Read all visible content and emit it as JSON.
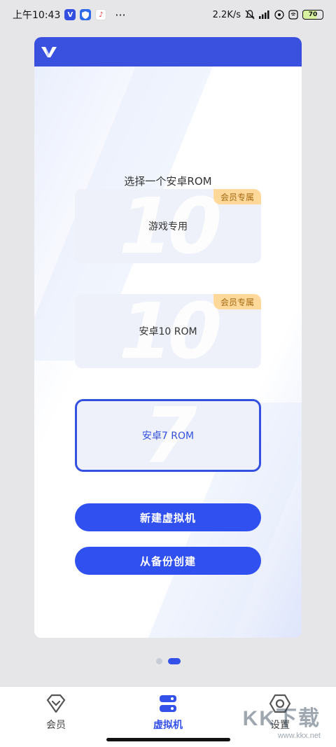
{
  "status_bar": {
    "time": "上午10:43",
    "more": "···",
    "network_speed": "2.2K/s",
    "battery": "70"
  },
  "main": {
    "choose_title": "选择一个安卓ROM",
    "options": [
      {
        "label": "游戏专用",
        "badge": "会员专属",
        "bg_number": "10"
      },
      {
        "label": "安卓10 ROM",
        "badge": "会员专属",
        "bg_number": "10"
      },
      {
        "label": "安卓7 ROM",
        "bg_number": "7"
      }
    ],
    "buttons": {
      "create_vm": "新建虚拟机",
      "create_from_backup": "从备份创建"
    }
  },
  "pager": {
    "page_count": 2,
    "active_index": 1
  },
  "bottom_nav": {
    "items": [
      {
        "label": "会员",
        "icon": "diamond-icon"
      },
      {
        "label": "虚拟机",
        "icon": "server-icon"
      },
      {
        "label": "设置",
        "icon": "settings-hex-icon"
      }
    ],
    "active_index": 1
  },
  "watermark": {
    "text": "KK下载",
    "url": "www.kkx.net"
  },
  "colors": {
    "accent": "#3350e8",
    "header": "#3a51e0",
    "badge": "#ffd89a"
  }
}
